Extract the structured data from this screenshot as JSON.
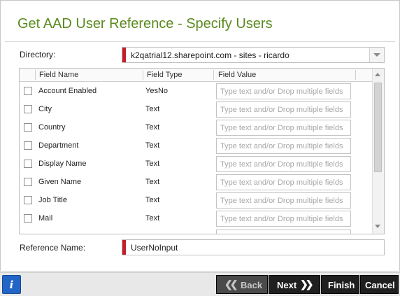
{
  "dialog": {
    "title": "Get AAD User Reference - Specify Users"
  },
  "directory": {
    "label": "Directory:",
    "value": "k2qatrial12.sharepoint.com - sites - ricardo"
  },
  "grid": {
    "columns": [
      "Field Name",
      "Field Type",
      "Field Value"
    ],
    "placeholder": "Type text and/or Drop multiple fields",
    "rows": [
      {
        "name": "Account Enabled",
        "type": "YesNo"
      },
      {
        "name": "City",
        "type": "Text"
      },
      {
        "name": "Country",
        "type": "Text"
      },
      {
        "name": "Department",
        "type": "Text"
      },
      {
        "name": "Display Name",
        "type": "Text"
      },
      {
        "name": "Given Name",
        "type": "Text"
      },
      {
        "name": "Job Title",
        "type": "Text"
      },
      {
        "name": "Mail",
        "type": "Text"
      }
    ]
  },
  "reference": {
    "label": "Reference Name:",
    "value": "UserNoInput"
  },
  "footer": {
    "info_icon": "info-icon",
    "back_label": "Back",
    "next_label": "Next",
    "finish_label": "Finish",
    "cancel_label": "Cancel"
  },
  "colors": {
    "title": "#5a8a1e",
    "required_marker": "#c21e2b",
    "info_button": "#2165c6"
  }
}
